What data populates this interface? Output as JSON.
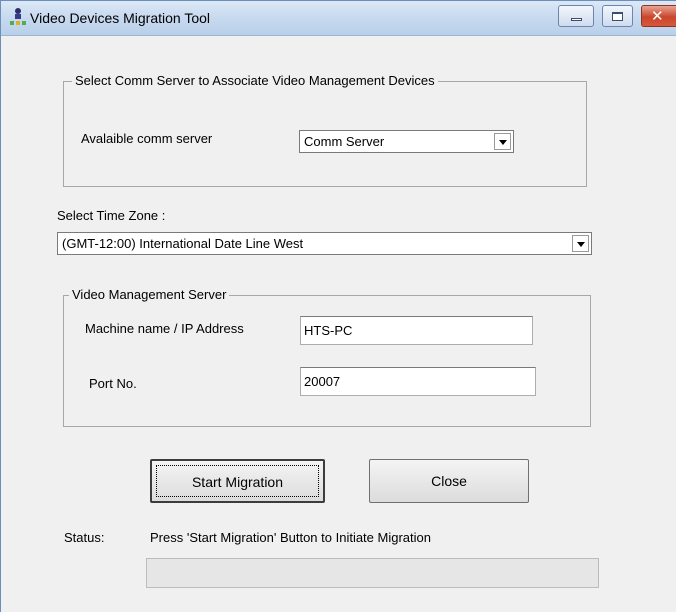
{
  "window": {
    "title": "Video Devices Migration Tool",
    "controls": [
      "minimize",
      "maximize",
      "close"
    ]
  },
  "comm_group": {
    "legend": "Select Comm Server to Associate Video Management Devices",
    "label": "Avalaible comm server",
    "selected": "Comm Server"
  },
  "timezone": {
    "label": "Select Time Zone :",
    "selected": "(GMT-12:00) International Date Line West"
  },
  "vms_group": {
    "legend": "Video Management Server",
    "machine_label": "Machine name / IP Address",
    "machine_value": "HTS-PC",
    "port_label": "Port No.",
    "port_value": "20007"
  },
  "buttons": {
    "start": "Start Migration",
    "close": "Close"
  },
  "status": {
    "label": "Status:",
    "message": "Press 'Start Migration' Button to Initiate Migration",
    "progress": 0
  },
  "icons": {
    "app": "app-people-icon",
    "dropdown": "dropdown-arrow-icon"
  }
}
